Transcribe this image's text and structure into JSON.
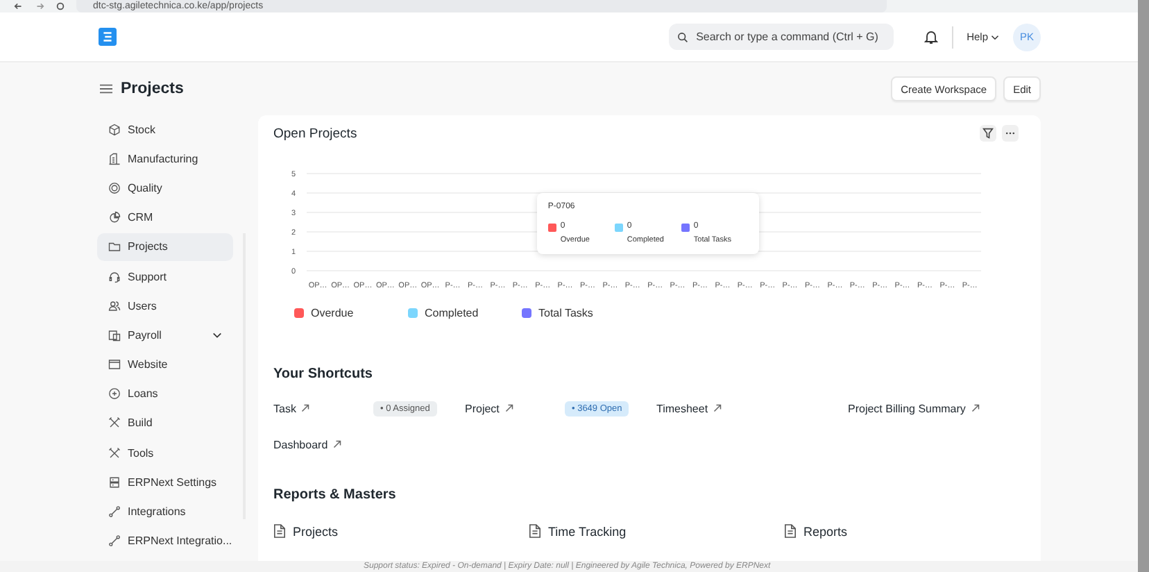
{
  "browser": {
    "url": "dtc-stg.agiletechnica.co.ke/app/projects"
  },
  "navbar": {
    "search": {
      "placeholder": "Search or type a command (Ctrl + G)"
    },
    "help": "Help",
    "avatar": "PK"
  },
  "page": {
    "title": "Projects",
    "actions": [
      "Create Workspace",
      "Edit"
    ]
  },
  "sidebar": {
    "items": [
      {
        "label": "Stock",
        "selected": false
      },
      {
        "label": "Manufacturing",
        "selected": false
      },
      {
        "label": "Quality",
        "selected": false
      },
      {
        "label": "CRM",
        "selected": false
      },
      {
        "label": "Projects",
        "selected": true
      },
      {
        "label": "Support",
        "selected": false
      },
      {
        "label": "Users",
        "selected": false
      },
      {
        "label": "Payroll",
        "selected": false,
        "expanded": false
      },
      {
        "label": "Website",
        "selected": false
      },
      {
        "label": "Loans",
        "selected": false
      },
      {
        "label": "Build",
        "selected": false
      },
      {
        "label": "Tools",
        "selected": false
      },
      {
        "label": "ERPNext Settings",
        "selected": false
      },
      {
        "label": "Integrations",
        "selected": false
      },
      {
        "label": "ERPNext Integratio...",
        "selected": false
      }
    ]
  },
  "open_projects": {
    "title": "Open Projects",
    "chart_data": {
      "type": "bar",
      "categories": [
        "OP…",
        "OP…",
        "OP…",
        "OP…",
        "OP…",
        "OP…",
        "P-…",
        "P-…",
        "P-…",
        "P-…",
        "P-…",
        "P-…",
        "P-…",
        "P-…",
        "P-…",
        "P-…",
        "P-…",
        "P-…",
        "P-…",
        "P-…",
        "P-…",
        "P-…",
        "P-…",
        "P-…",
        "P-…",
        "P-…",
        "P-…",
        "P-…",
        "P-…",
        "P-…"
      ],
      "series": [
        {
          "name": "Overdue",
          "color": "#ff5858",
          "values": [
            0,
            0,
            0,
            0,
            0,
            0,
            0,
            0,
            0,
            0,
            0,
            0,
            0,
            0,
            0,
            0,
            0,
            0,
            0,
            0,
            0,
            0,
            0,
            0,
            0,
            0,
            0,
            0,
            0,
            0
          ]
        },
        {
          "name": "Completed",
          "color": "#7cd6fd",
          "values": [
            0,
            0,
            0,
            0,
            0,
            0,
            0,
            0,
            0,
            0,
            0,
            0,
            0,
            0,
            0,
            0,
            0,
            0,
            0,
            0,
            0,
            0,
            0,
            0,
            0,
            0,
            0,
            0,
            0,
            0
          ]
        },
        {
          "name": "Total Tasks",
          "color": "#7575ff",
          "values": [
            0,
            0,
            0,
            0,
            0,
            0,
            0,
            0,
            0,
            0,
            0,
            0,
            0,
            0,
            0,
            0,
            0,
            0,
            0,
            0,
            0,
            0,
            0,
            0,
            0,
            0,
            0,
            0,
            0,
            0
          ]
        }
      ],
      "ylim": [
        0,
        5
      ],
      "yticks": [
        0,
        1,
        2,
        3,
        4,
        5
      ],
      "grid": true
    },
    "tooltip": {
      "title": "P-0706",
      "items": [
        {
          "value": "0",
          "label": "Overdue",
          "color": "#ff5858"
        },
        {
          "value": "0",
          "label": "Completed",
          "color": "#7cd6fd"
        },
        {
          "value": "0",
          "label": "Total Tasks",
          "color": "#7575ff"
        }
      ]
    }
  },
  "shortcuts": {
    "title": "Your Shortcuts",
    "items": [
      {
        "label": "Task",
        "badge": {
          "text": "• 0 Assigned",
          "color": "#ebeef0"
        }
      },
      {
        "label": "Project",
        "badge": {
          "text": "• 3649 Open",
          "color": "#d6ebfb"
        }
      },
      {
        "label": "Timesheet"
      },
      {
        "label": "Project Billing Summary"
      },
      {
        "label": "Dashboard"
      }
    ]
  },
  "reports": {
    "title": "Reports & Masters",
    "items": [
      "Projects",
      "Time Tracking",
      "Reports"
    ]
  },
  "footer": "Support status: Expired - On-demand | Expiry Date: null | Engineered by Agile Technica, Powered by ERPNext"
}
